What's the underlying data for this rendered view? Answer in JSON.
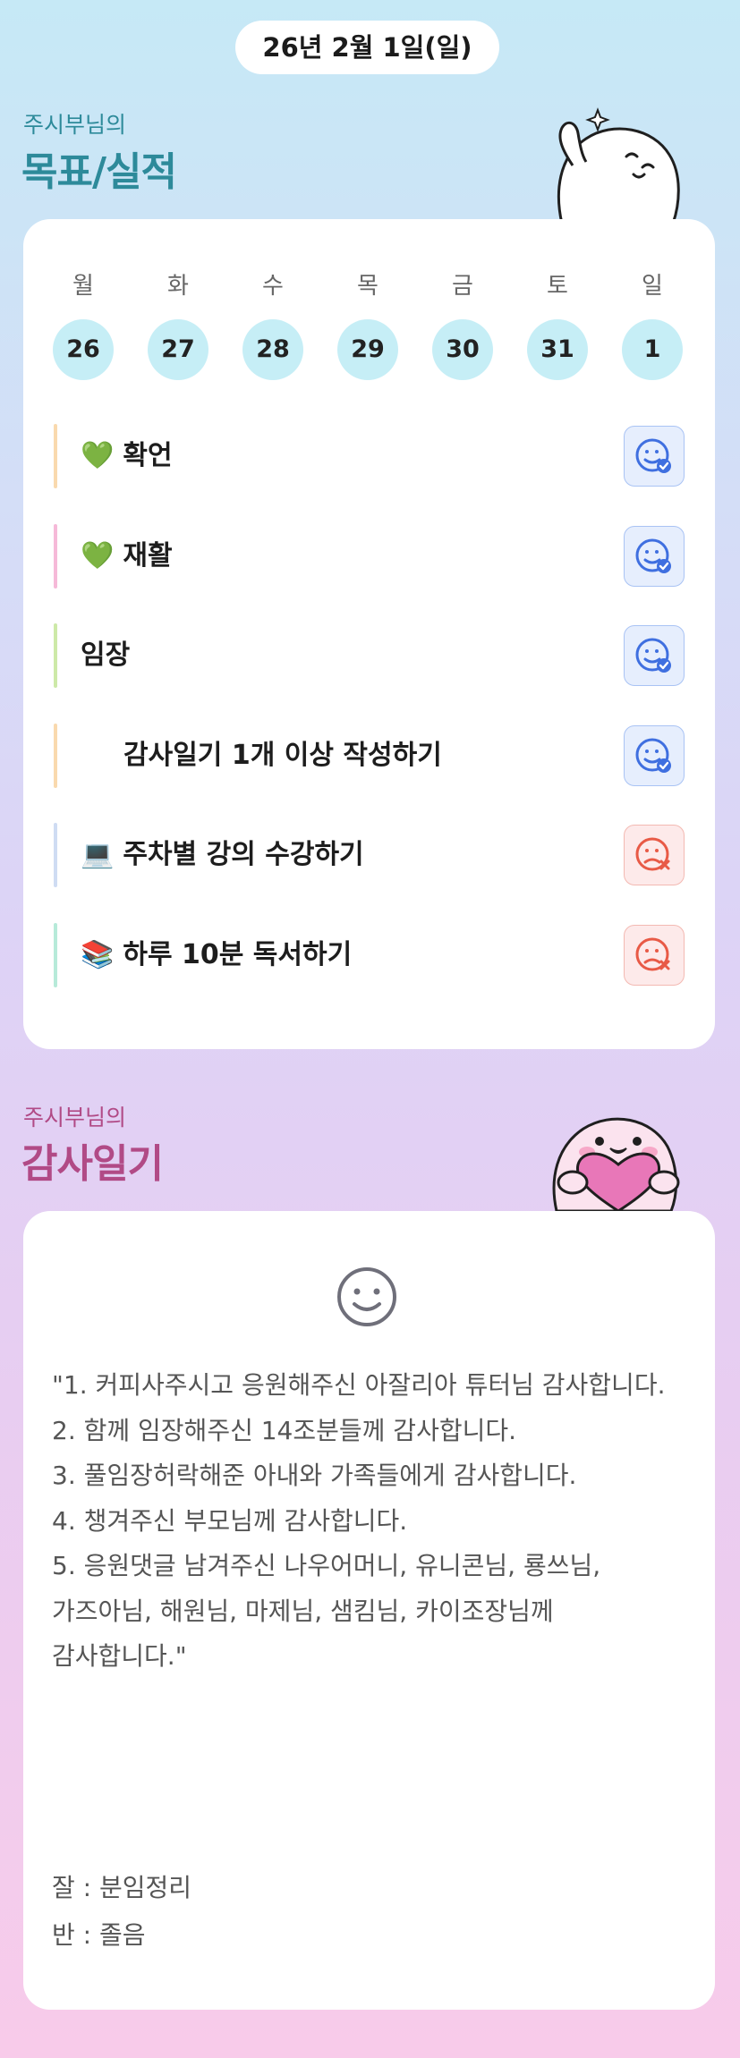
{
  "header": {
    "date": "26년 2월 1일(일)"
  },
  "goals_section": {
    "subtitle": "주시부님의",
    "title": "목표/실적"
  },
  "week": {
    "days": [
      {
        "weekday": "월",
        "date": "26"
      },
      {
        "weekday": "화",
        "date": "27"
      },
      {
        "weekday": "수",
        "date": "28"
      },
      {
        "weekday": "목",
        "date": "29"
      },
      {
        "weekday": "금",
        "date": "30"
      },
      {
        "weekday": "토",
        "date": "31"
      },
      {
        "weekday": "일",
        "date": "1"
      }
    ]
  },
  "goals": [
    {
      "emoji": "💚",
      "label": "확언",
      "status": "done",
      "bar_color": "#f9d9ae",
      "status_icon": "smile-check-icon"
    },
    {
      "emoji": "💚",
      "label": "재활",
      "status": "done",
      "bar_color": "#f6b9d8",
      "status_icon": "smile-check-icon"
    },
    {
      "emoji": "",
      "label": "임장",
      "status": "done",
      "bar_color": "#cde9a8",
      "status_icon": "smile-check-icon"
    },
    {
      "emoji": "",
      "label": "감사일기 1개 이상 작성하기",
      "status": "done",
      "bar_color": "#f9d9ae",
      "status_icon": "smile-check-icon"
    },
    {
      "emoji": "💻",
      "label": "주차별 강의 수강하기",
      "status": "undone",
      "bar_color": "#cfdcf3",
      "status_icon": "sad-x-icon"
    },
    {
      "emoji": "📚",
      "label": "하루 10분 독서하기",
      "status": "undone",
      "bar_color": "#b7ead9",
      "status_icon": "sad-x-icon"
    }
  ],
  "diary_section": {
    "subtitle": "주시부님의",
    "title": "감사일기"
  },
  "diary": {
    "mood_icon": "smile-face-icon",
    "body": "\"1. 커피사주시고 응원해주신 아잘리아 튜터님 감사합니다.\n2. 함께 임장해주신 14조분들께 감사합니다.\n3. 풀임장허락해준 아내와 가족들에게 감사합니다.\n4. 챙겨주신 부모님께 감사합니다.\n5. 응원댓글 남겨주신 나우어머니, 유니콘님, 룡쓰님, 가즈아님, 해원님, 마제님, 샘킴님, 카이조장님께 감사합니다.\"",
    "good_label": "잘 : 분임정리",
    "bad_label": "반 : 졸음"
  },
  "colors": {
    "goals_title": "#2d8a9a",
    "diary_title": "#b14a86",
    "done_icon": "#3f6fe0",
    "undone_icon": "#e85a46"
  }
}
